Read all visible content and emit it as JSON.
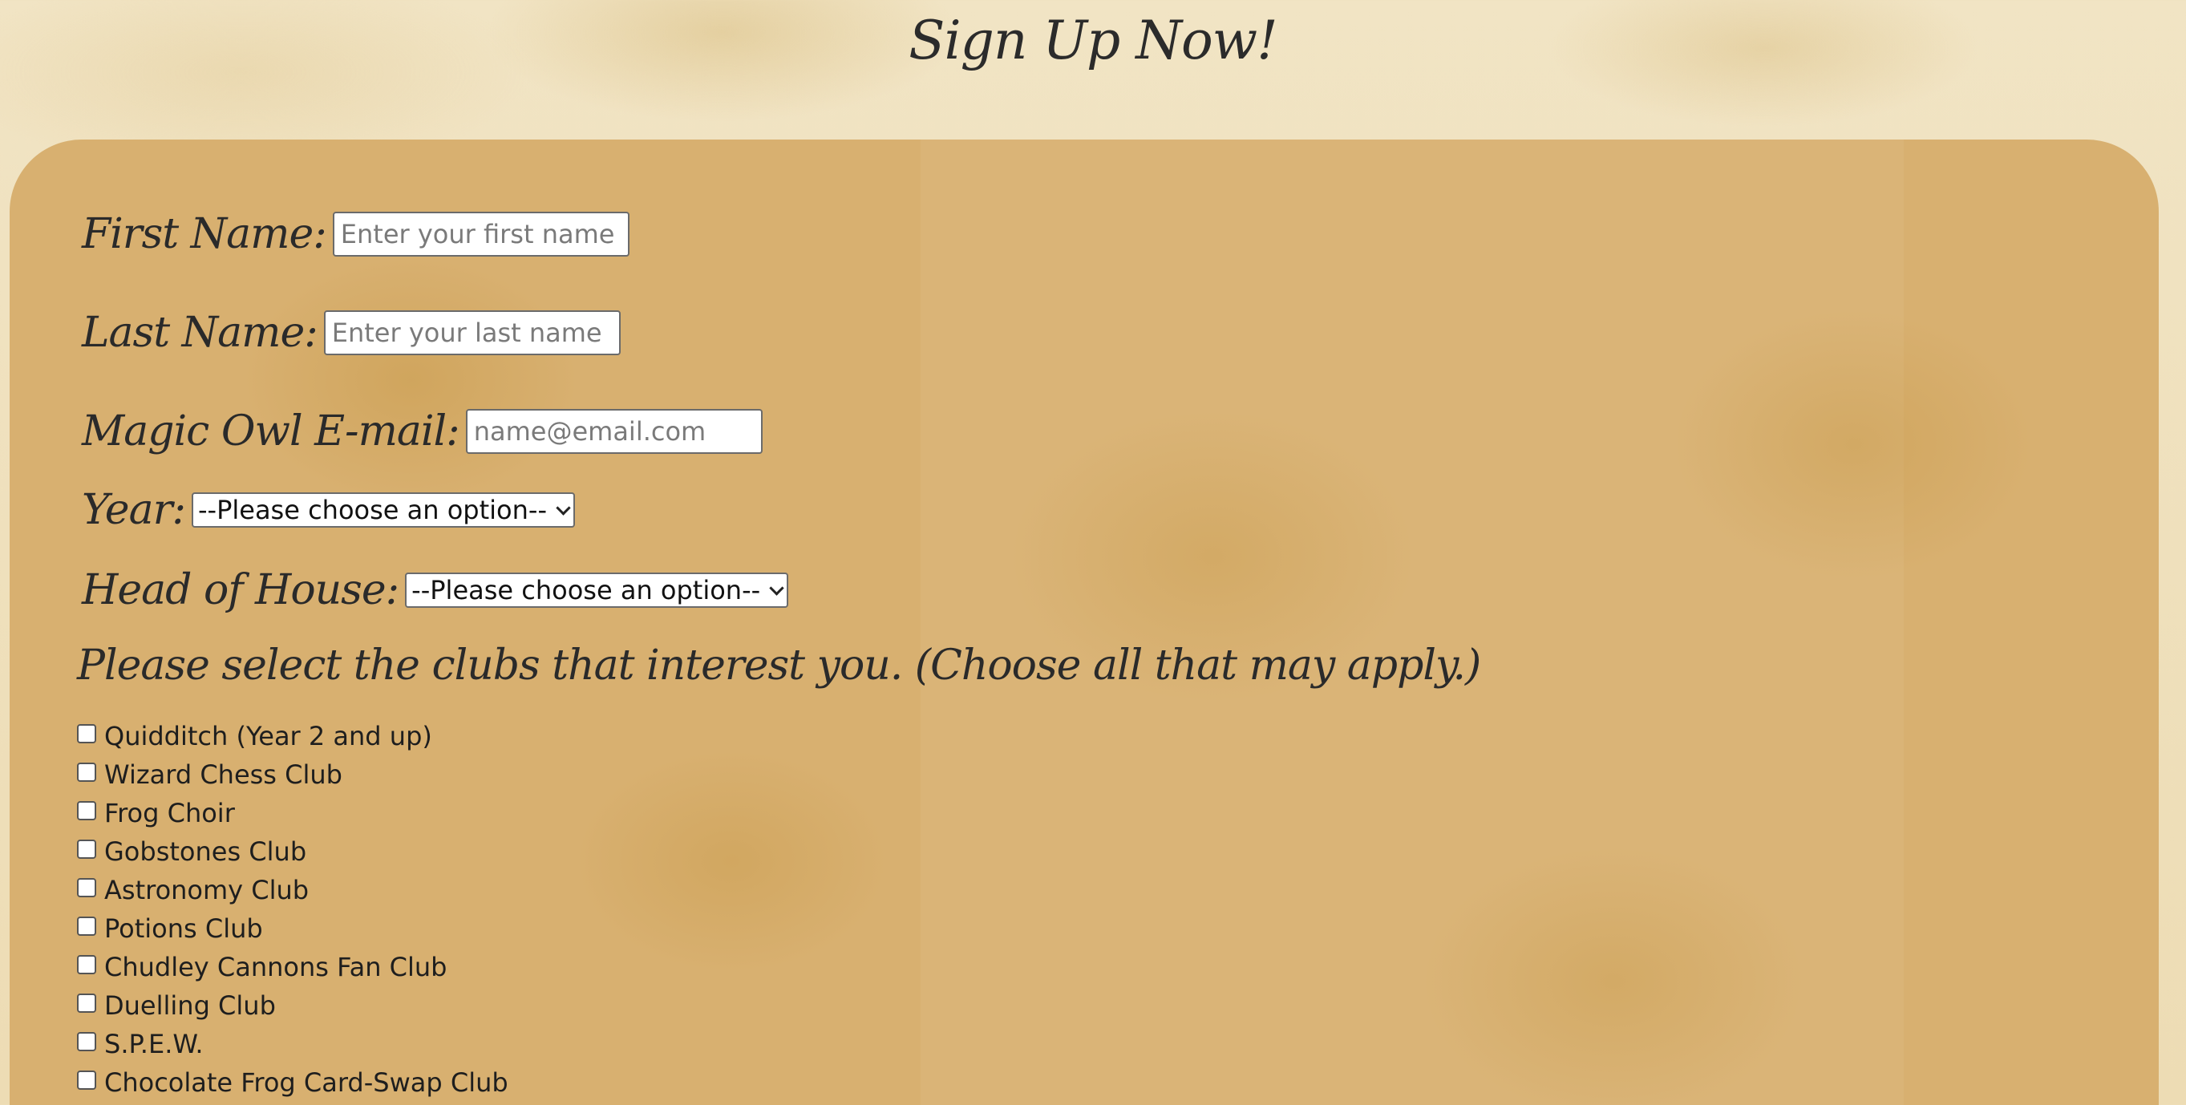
{
  "page": {
    "title": "Sign Up Now!"
  },
  "form": {
    "first_name": {
      "label": "First Name:",
      "placeholder": "Enter your first name"
    },
    "last_name": {
      "label": "Last Name:",
      "placeholder": "Enter your last name"
    },
    "email": {
      "label": "Magic Owl E-mail:",
      "placeholder": "name@email.com"
    },
    "year": {
      "label": "Year:",
      "selected": "--Please choose an option--"
    },
    "head_of_house": {
      "label": "Head of House:",
      "selected": "--Please choose an option--"
    },
    "clubs": {
      "heading": "Please select the clubs that interest you. (Choose all that may apply.)",
      "options": [
        "Quidditch (Year 2 and up)",
        "Wizard Chess Club",
        "Frog Choir",
        "Gobstones Club",
        "Astronomy Club",
        "Potions Club",
        "Chudley Cannons Fan Club",
        "Duelling Club",
        "S.P.E.W.",
        "Chocolate Frog Card-Swap Club"
      ]
    }
  },
  "colors": {
    "page_background": "#efe0bc",
    "panel_background": "#d8b070",
    "text": "#2a2a2a"
  },
  "icons": {
    "select_arrow": "chevron-down-icon"
  }
}
